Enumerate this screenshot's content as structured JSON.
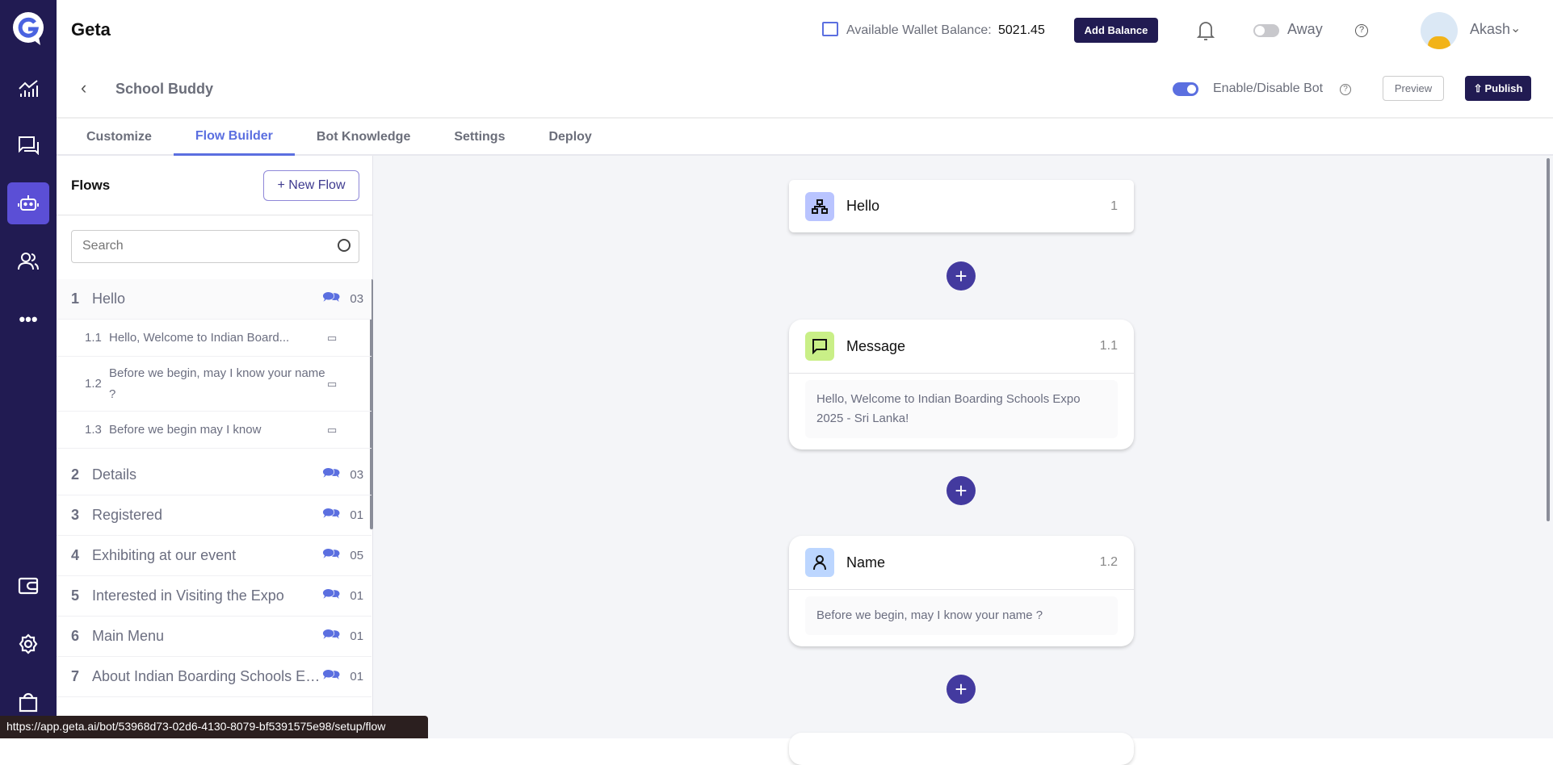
{
  "app": {
    "name": "Geta"
  },
  "header": {
    "wallet_label": "Available Wallet Balance:",
    "wallet_value": "5021.45",
    "add_balance": "Add Balance",
    "status": "Away",
    "user": "Akash"
  },
  "subheader": {
    "title": "School Buddy",
    "toggle_label": "Enable/Disable Bot",
    "preview": "Preview",
    "publish": "Publish"
  },
  "tabs": [
    "Customize",
    "Flow Builder",
    "Bot Knowledge",
    "Settings",
    "Deploy"
  ],
  "flows": {
    "title": "Flows",
    "new_flow": "+ New Flow",
    "search_placeholder": "Search",
    "items": [
      {
        "num": "1",
        "label": "Hello",
        "count": "03"
      },
      {
        "num": "2",
        "label": "Details",
        "count": "03"
      },
      {
        "num": "3",
        "label": "Registered",
        "count": "01"
      },
      {
        "num": "4",
        "label": "Exhibiting at our event",
        "count": "05"
      },
      {
        "num": "5",
        "label": "Interested in Visiting the Expo",
        "count": "01"
      },
      {
        "num": "6",
        "label": "Main Menu",
        "count": "01"
      },
      {
        "num": "7",
        "label": "About Indian Boarding Schools Expo",
        "count": "01"
      }
    ],
    "subitems": [
      {
        "num": "1.1",
        "label": "Hello, Welcome to Indian Board..."
      },
      {
        "num": "1.2",
        "label": "Before we begin, may I know your name ?"
      },
      {
        "num": "1.3",
        "label": "Before we begin may I know"
      }
    ]
  },
  "canvas": {
    "cards": [
      {
        "title": "Hello",
        "num": "1"
      },
      {
        "title": "Message",
        "num": "1.1",
        "text": "Hello, Welcome to Indian Boarding Schools Expo 2025 - Sri Lanka!"
      },
      {
        "title": "Name",
        "num": "1.2",
        "text": "Before we begin, may I know your name ?"
      }
    ]
  },
  "status_url": "https://app.geta.ai/bot/53968d73-02d6-4130-8079-bf5391575e98/setup/flow"
}
